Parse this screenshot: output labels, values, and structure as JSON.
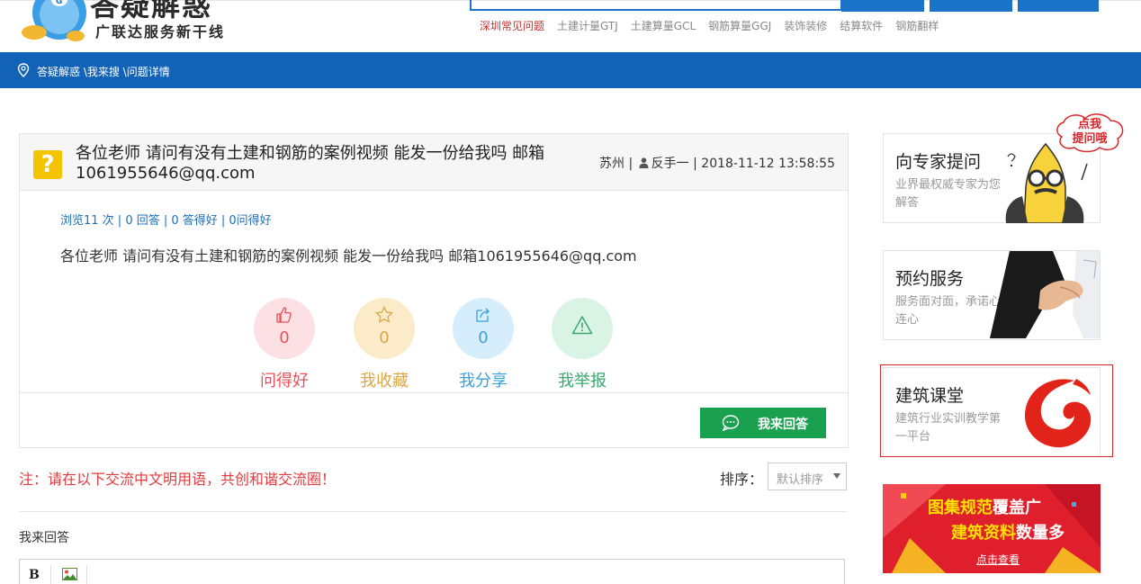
{
  "header": {
    "logo_title": "答疑解惑",
    "logo_subtitle": "广联达服务新干线",
    "hot_links": [
      "深圳常见问题",
      "土建计量GTJ",
      "土建算量GCL",
      "钢筋算量GGJ",
      "装饰装修",
      "结算软件",
      "钢筋翻样"
    ]
  },
  "breadcrumb": {
    "text": "答疑解惑 \\我来搜 \\问题详情"
  },
  "question": {
    "title": "各位老师 请问有没有土建和钢筋的案例视频 能发一份给我吗 邮箱1061955646@qq.com",
    "location": "苏州",
    "user": "反手一",
    "time": "2018-11-12 13:58:55",
    "stats": "浏览11 次 | 0 回答 | 0 答得好 | 0问得好",
    "body": "各位老师 请问有没有土建和钢筋的案例视频 能发一份给我吗 邮箱1061955646@qq.com",
    "actions": [
      {
        "label": "问得好",
        "count": "0",
        "color": "#e8505b",
        "bg": "#fde0e3"
      },
      {
        "label": "我收藏",
        "count": "0",
        "color": "#d9a64a",
        "bg": "#fcebc8"
      },
      {
        "label": "我分享",
        "count": "0",
        "color": "#3b9fd8",
        "bg": "#d6edfb"
      },
      {
        "label": "我举报",
        "count": "",
        "color": "#3aa870",
        "bg": "#d9f3e4"
      }
    ],
    "reply_button": "我来回答"
  },
  "answers": {
    "notice": "注：请在以下交流中文明用语，共创和谐交流圈！",
    "sort_label": "排序：",
    "sort_value": "默认排序",
    "my_answer_label": "我来回答",
    "editor_bold": "B"
  },
  "sidebar": {
    "bubble": "点我\n提问哦",
    "cards": [
      {
        "title": "向专家提问",
        "desc": "业界最权威专家为您解答"
      },
      {
        "title": "预约服务",
        "desc": "服务面对面，承诺心连心"
      },
      {
        "title": "建筑课堂",
        "desc": "建筑行业实训教学第一平台"
      }
    ],
    "banner": {
      "line1_a": "图集规范",
      "line1_b": "覆盖广",
      "line2_a": "建筑资料",
      "line2_b": "数量多",
      "link": "点击查看"
    }
  },
  "colors": {
    "primary_blue": "#1263b7",
    "reply_green": "#1aa14f",
    "notice_red": "#e4393c"
  }
}
